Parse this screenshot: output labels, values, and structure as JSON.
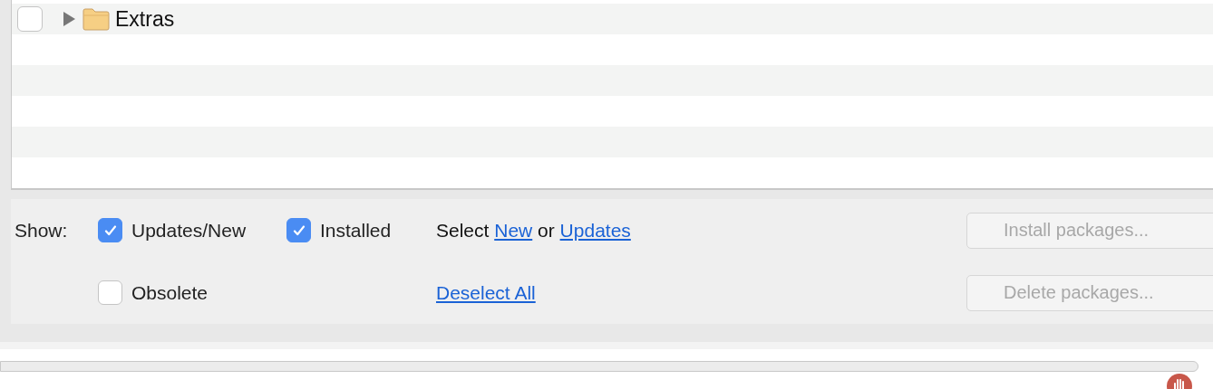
{
  "tree": {
    "rows": [
      {
        "label": "Extras",
        "checked": false,
        "expanded": false
      }
    ]
  },
  "filters": {
    "label": "Show:",
    "options": [
      {
        "label": "Updates/New",
        "checked": true
      },
      {
        "label": "Installed",
        "checked": true
      },
      {
        "label": "Obsolete",
        "checked": false
      }
    ]
  },
  "selection": {
    "prefix": "Select",
    "new_link": "New",
    "joiner": "or",
    "updates_link": "Updates",
    "deselect_link": "Deselect All"
  },
  "buttons": [
    {
      "label": "Install packages...",
      "disabled": true
    },
    {
      "label": "Delete packages...",
      "disabled": true
    }
  ]
}
